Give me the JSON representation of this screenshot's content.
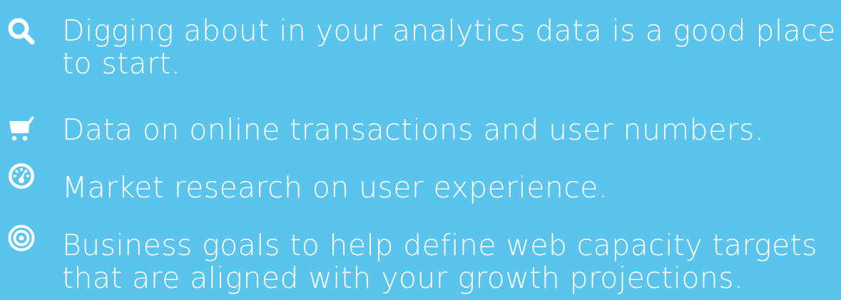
{
  "theme": {
    "background": "#5bc4ec",
    "text_color": "#ffffff"
  },
  "items": [
    {
      "icon": "search-icon",
      "lines": [
        "Digging about in your analytics data is a good place",
        "to start."
      ]
    },
    {
      "icon": "shopping-cart-icon",
      "lines": [
        "Data on online transactions and user numbers."
      ]
    },
    {
      "icon": "gauge-icon",
      "lines": [
        "Market research on user experience."
      ]
    },
    {
      "icon": "target-icon",
      "lines": [
        "Business goals to help define web capacity targets",
        "that are aligned with your growth projections."
      ]
    }
  ]
}
